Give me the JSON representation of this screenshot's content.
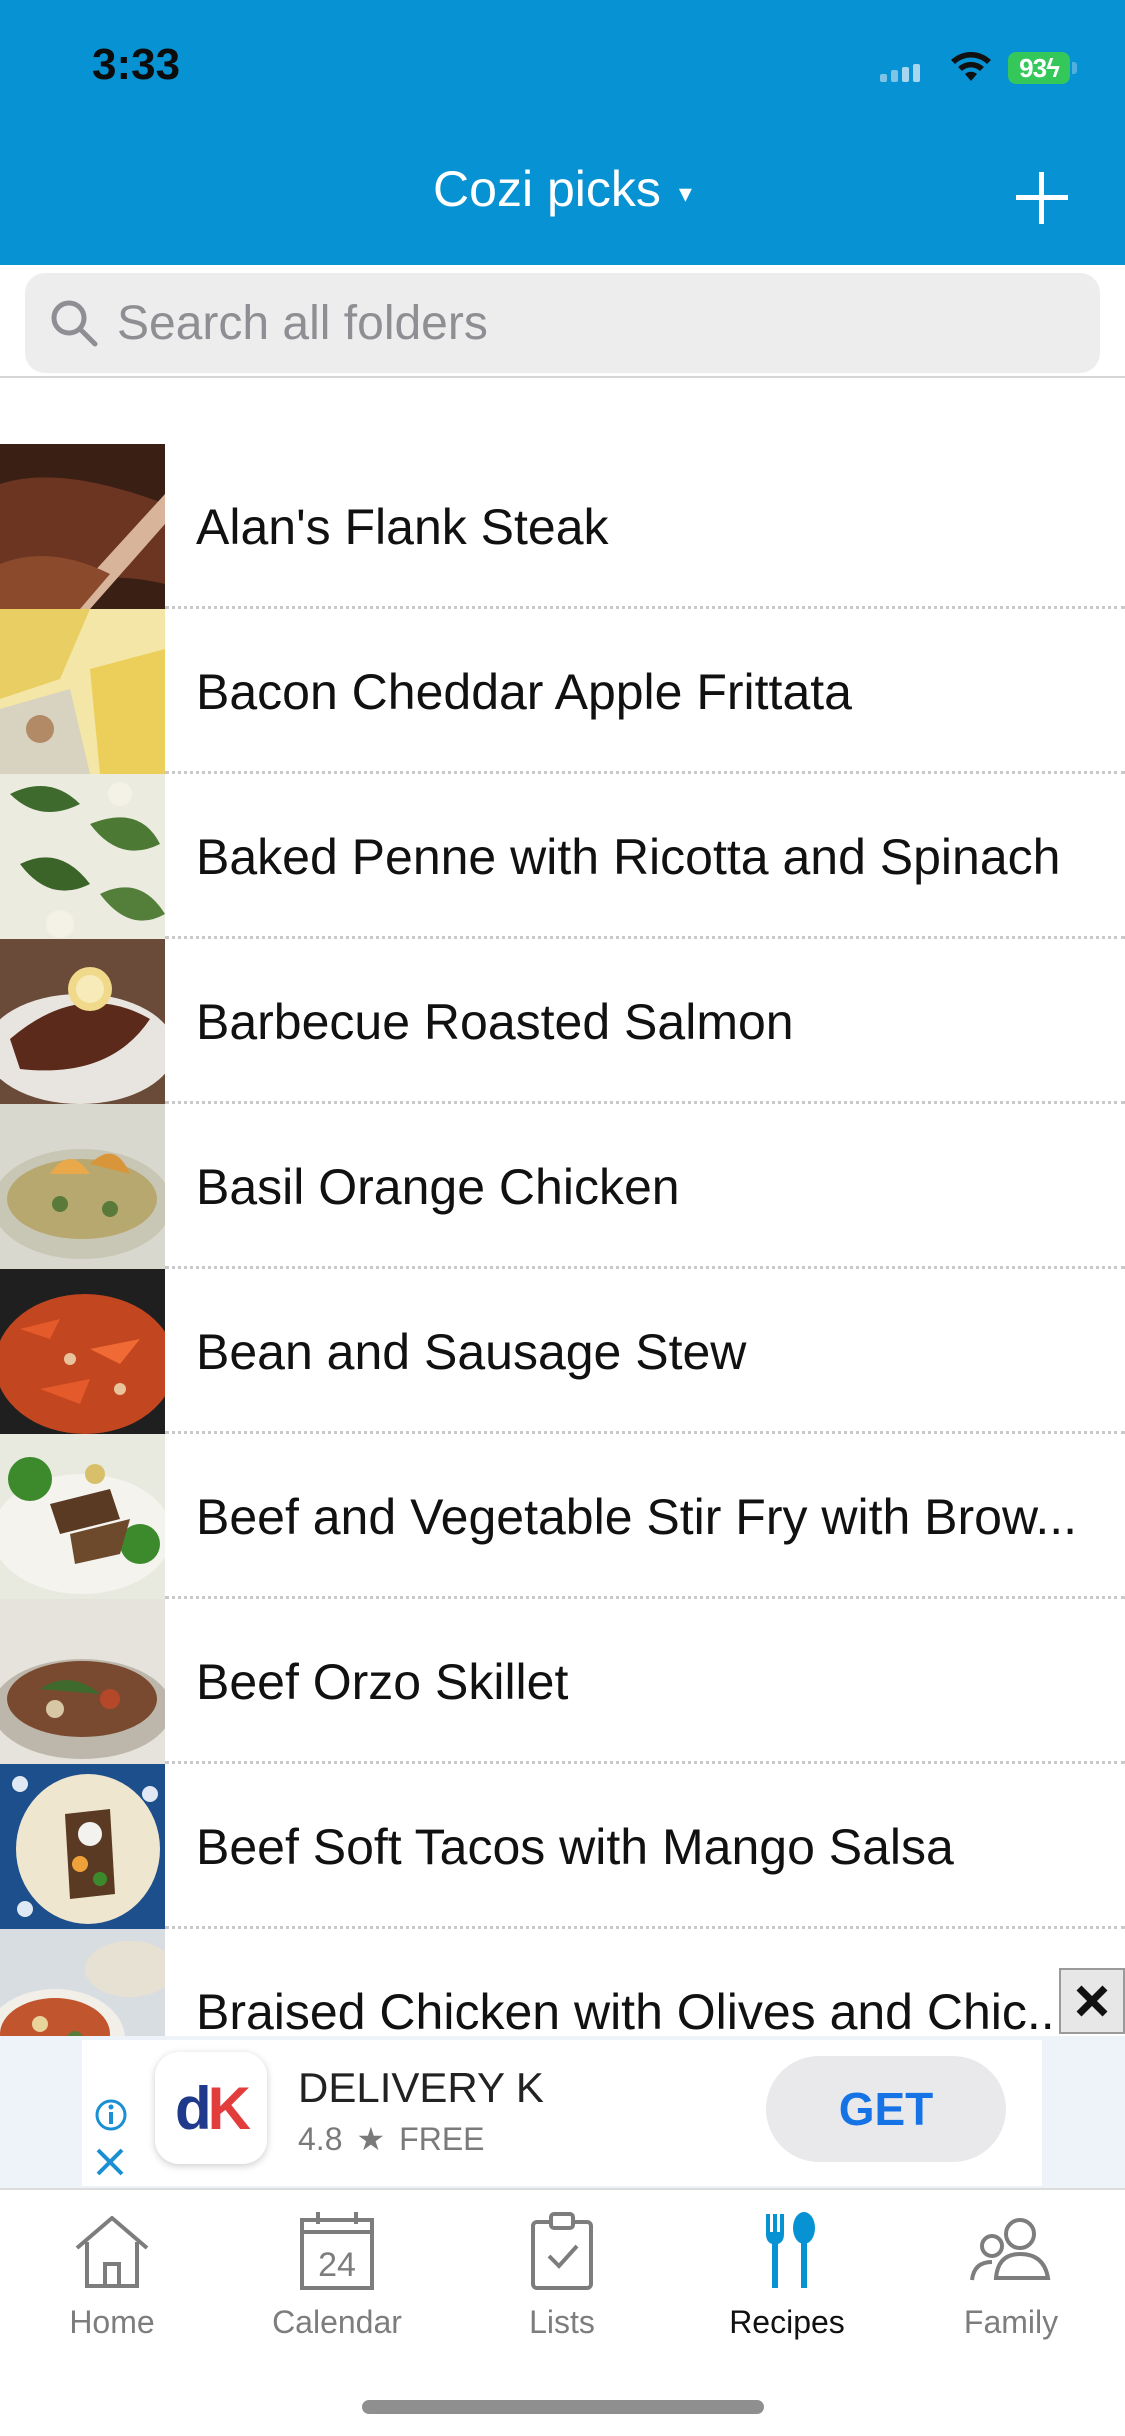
{
  "status_bar": {
    "time": "3:33",
    "battery": "93"
  },
  "header": {
    "title": "Cozi picks",
    "caret": "▾",
    "add_icon": "plus-icon"
  },
  "search": {
    "placeholder": "Search all folders",
    "value": ""
  },
  "recipes": [
    {
      "name": "Alan's Flank Steak"
    },
    {
      "name": "Bacon Cheddar Apple Frittata"
    },
    {
      "name": "Baked Penne with Ricotta and Spinach"
    },
    {
      "name": "Barbecue Roasted Salmon"
    },
    {
      "name": "Basil Orange Chicken"
    },
    {
      "name": "Bean and Sausage Stew"
    },
    {
      "name": "Beef and Vegetable Stir Fry with Brow..."
    },
    {
      "name": "Beef Orzo Skillet"
    },
    {
      "name": "Beef Soft Tacos with Mango Salsa"
    },
    {
      "name": "Braised Chicken with Olives and Chic..."
    }
  ],
  "ad": {
    "logo_d": "d",
    "logo_k": "K",
    "name": "DELIVERY K",
    "rating": "4.8",
    "price": "FREE",
    "cta": "GET"
  },
  "tabs": [
    {
      "label": "Home",
      "icon": "home-icon",
      "active": false
    },
    {
      "label": "Calendar",
      "icon": "calendar-icon",
      "calendar_day": "24",
      "active": false
    },
    {
      "label": "Lists",
      "icon": "clipboard-check-icon",
      "active": false
    },
    {
      "label": "Recipes",
      "icon": "fork-spoon-icon",
      "active": true
    },
    {
      "label": "Family",
      "icon": "people-icon",
      "active": false
    }
  ],
  "colors": {
    "header": "#0793d3",
    "accent": "#0793d3",
    "get_button_text": "#1573e6"
  }
}
